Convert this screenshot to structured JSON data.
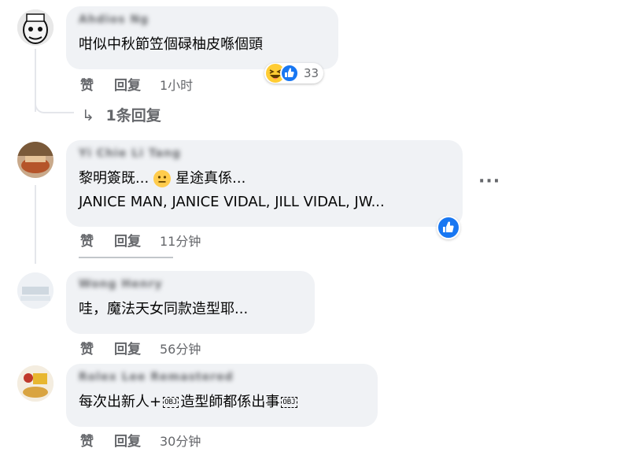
{
  "comments": [
    {
      "author": "Ahdios Ng",
      "text": "咁似中秋節笠個碌柚皮喺個頭",
      "actions": {
        "like": "赞",
        "reply": "回复",
        "time": "1小时"
      },
      "reaction_count": "33",
      "replies_link": "1条回复"
    },
    {
      "author": "Yi Chie Li Tang",
      "text_line1_a": "黎明簽既...",
      "text_line1_b": "星途真係...",
      "text_line2": "JANICE MAN, JANICE VIDAL, JILL VIDAL, JW...",
      "actions": {
        "like": "赞",
        "reply": "回复",
        "time": "11分钟"
      }
    },
    {
      "author": "Wong Henry",
      "text": "哇，魔法天女同款造型耶...",
      "actions": {
        "like": "赞",
        "reply": "回复",
        "time": "56分钟"
      }
    },
    {
      "author": "Rolex Lee Remastered",
      "text_a": "每次出新人+",
      "obj": "OBJ",
      "text_b": "造型師都係出事",
      "actions": {
        "like": "赞",
        "reply": "回复",
        "time": "30分钟"
      }
    }
  ],
  "colors": {
    "like_blue": "#1877f2",
    "bubble": "#f0f2f5",
    "muted": "#65676b"
  }
}
